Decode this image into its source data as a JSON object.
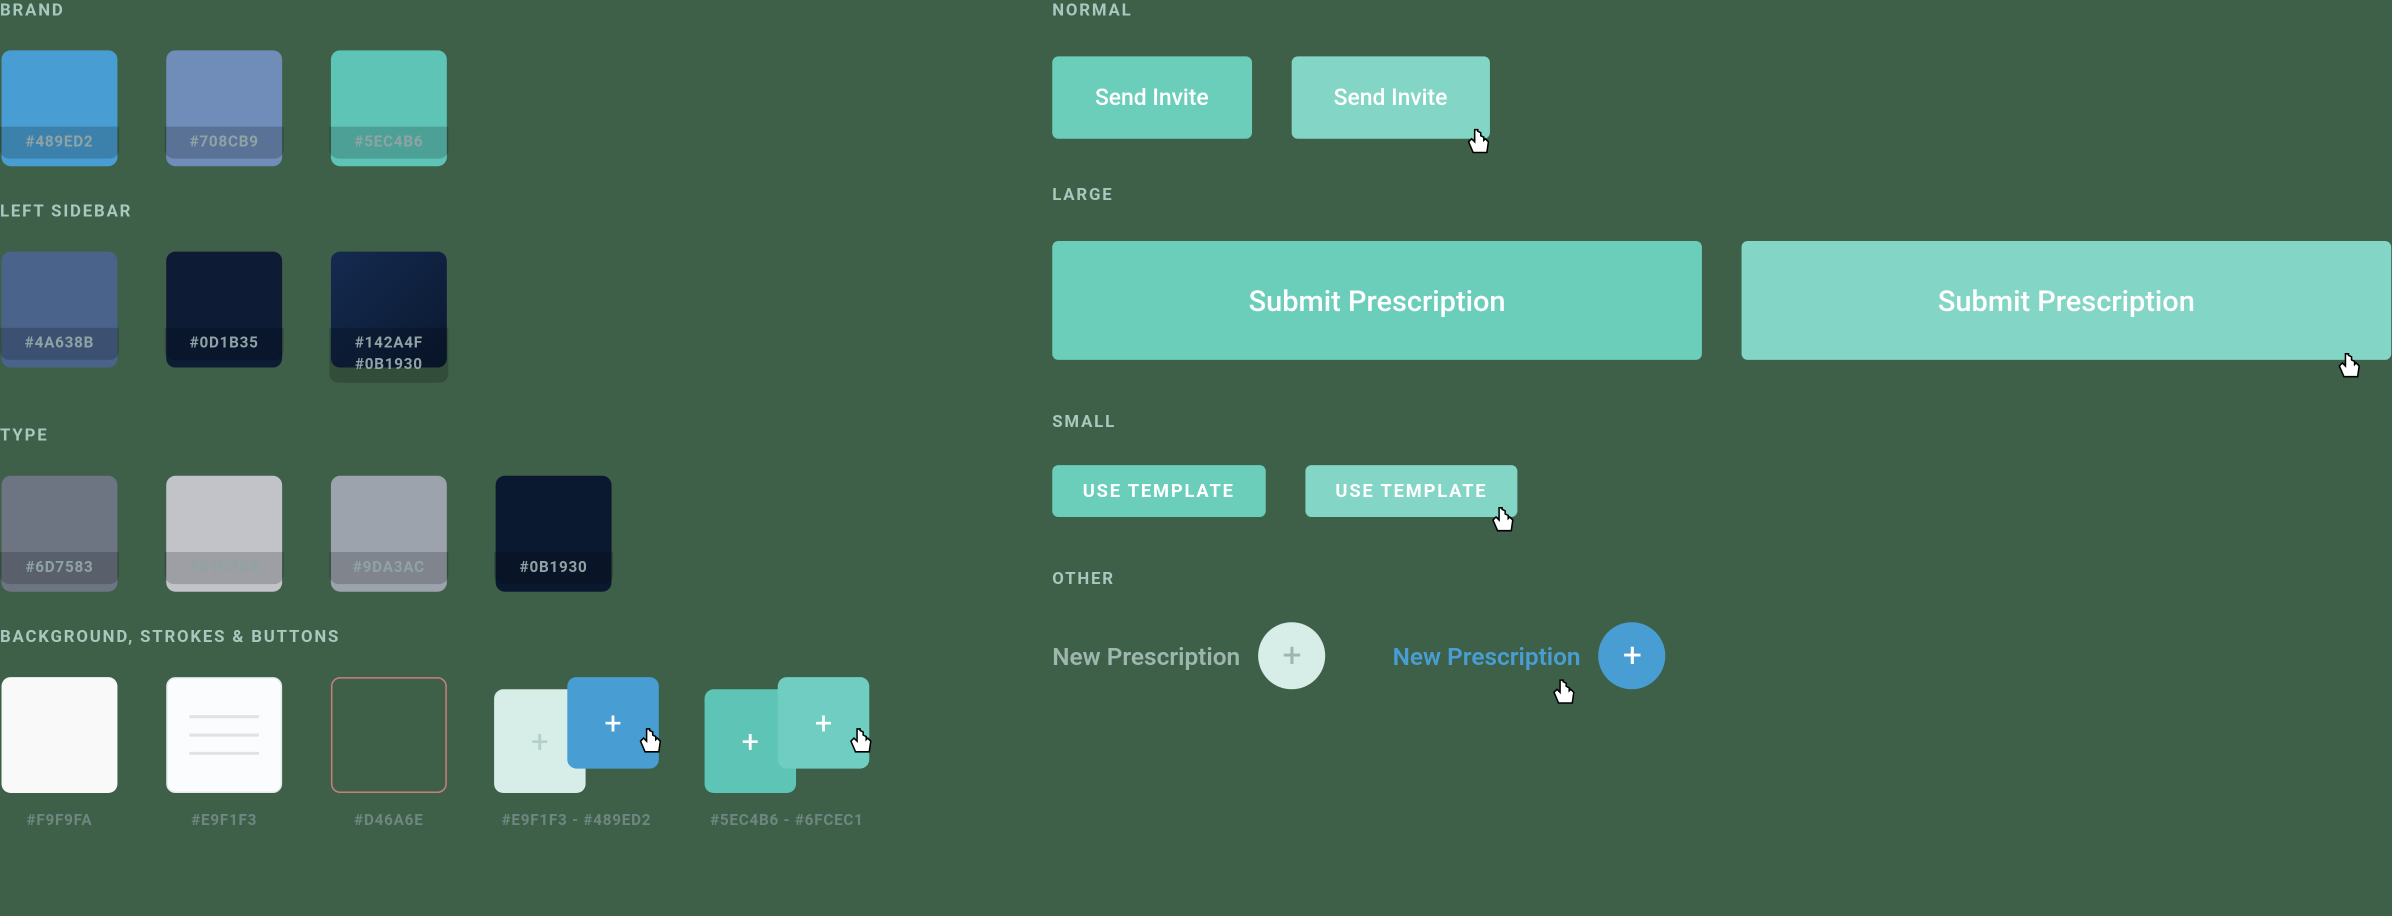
{
  "left": {
    "brand": {
      "heading": "BRAND",
      "swatches": [
        "#489ED2",
        "#708CB9",
        "#5EC4B6"
      ]
    },
    "sidebar": {
      "heading": "LEFT SIDEBAR",
      "swatches": [
        "#4A638B",
        "#0D1B35",
        "#142A4F\n#0B1930"
      ]
    },
    "type": {
      "heading": "TYPE",
      "swatches": [
        "#6D7583",
        "#C1C3C8",
        "#9DA3AC",
        "#0B1930"
      ]
    },
    "bg": {
      "heading": "BACKGROUND, STROKES & BUTTONS",
      "labels": [
        "#F9F9FA",
        "#E9F1F3",
        "#D46A6E",
        "#E9F1F3 - #489ED2",
        "#5EC4B6 - #6FCEC1"
      ]
    }
  },
  "right": {
    "normal": {
      "heading": "NORMAL",
      "label": "Send Invite"
    },
    "large": {
      "heading": "LARGE",
      "label": "Submit Prescription"
    },
    "small": {
      "heading": "SMALL",
      "label": "USE TEMPLATE"
    },
    "other": {
      "heading": "OTHER",
      "label": "New Prescription"
    }
  }
}
